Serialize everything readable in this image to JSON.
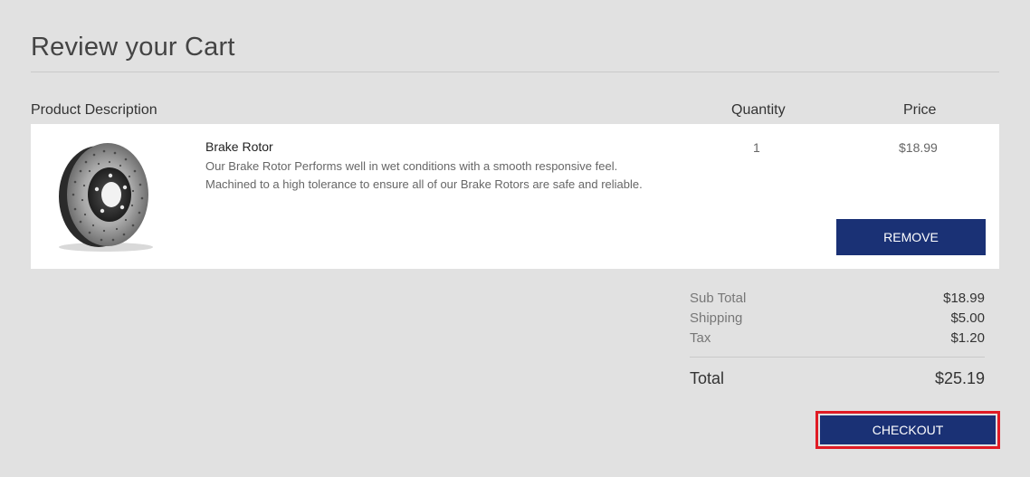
{
  "page": {
    "title": "Review your Cart"
  },
  "columns": {
    "product": "Product Description",
    "quantity": "Quantity",
    "price": "Price"
  },
  "items": [
    {
      "name": "Brake Rotor",
      "description_line1": "Our Brake Rotor Performs well in wet conditions with a smooth responsive feel.",
      "description_line2": "Machined to a high tolerance to ensure all of our Brake Rotors are safe and reliable.",
      "quantity": "1",
      "price": "$18.99",
      "remove_label": "REMOVE",
      "image_icon": "brake-rotor-image"
    }
  ],
  "summary": {
    "subtotal_label": "Sub Total",
    "subtotal_value": "$18.99",
    "shipping_label": "Shipping",
    "shipping_value": "$5.00",
    "tax_label": "Tax",
    "tax_value": "$1.20",
    "total_label": "Total",
    "total_value": "$25.19"
  },
  "actions": {
    "checkout_label": "CHECKOUT"
  },
  "colors": {
    "background": "#e1e1e1",
    "button": "#1a3175",
    "highlight": "#e01b24"
  }
}
